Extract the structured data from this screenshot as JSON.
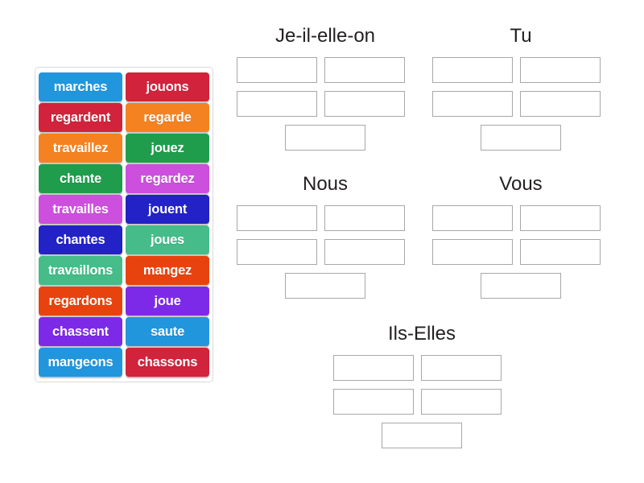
{
  "word_bank": {
    "label": "word-bank",
    "tiles": [
      {
        "text": "marches",
        "color": "#2196dd"
      },
      {
        "text": "jouons",
        "color": "#d1233b"
      },
      {
        "text": "regardent",
        "color": "#d1233b"
      },
      {
        "text": "regarde",
        "color": "#f58220"
      },
      {
        "text": "travaillez",
        "color": "#f58220"
      },
      {
        "text": "jouez",
        "color": "#1f9d4d"
      },
      {
        "text": "chante",
        "color": "#1f9d4d"
      },
      {
        "text": "regardez",
        "color": "#cc4fdd"
      },
      {
        "text": "travailles",
        "color": "#cc4fdd"
      },
      {
        "text": "jouent",
        "color": "#2222c7"
      },
      {
        "text": "chantes",
        "color": "#2222c7"
      },
      {
        "text": "joues",
        "color": "#45bc8a"
      },
      {
        "text": "travaillons",
        "color": "#45bc8a"
      },
      {
        "text": "mangez",
        "color": "#e8430f"
      },
      {
        "text": "regardons",
        "color": "#e8430f"
      },
      {
        "text": "joue",
        "color": "#7d2ae8"
      },
      {
        "text": "chassent",
        "color": "#7d2ae8"
      },
      {
        "text": "saute",
        "color": "#2196dd"
      },
      {
        "text": "mangeons",
        "color": "#2196dd"
      },
      {
        "text": "chassons",
        "color": "#d1233b"
      }
    ]
  },
  "groups": [
    {
      "id": "je",
      "title": "Je-il-elle-on",
      "slot_count": 5,
      "slots": [
        "",
        "",
        "",
        "",
        ""
      ]
    },
    {
      "id": "tu",
      "title": "Tu",
      "slot_count": 5,
      "slots": [
        "",
        "",
        "",
        "",
        ""
      ]
    },
    {
      "id": "nous",
      "title": "Nous",
      "slot_count": 5,
      "slots": [
        "",
        "",
        "",
        "",
        ""
      ]
    },
    {
      "id": "vous",
      "title": "Vous",
      "slot_count": 5,
      "slots": [
        "",
        "",
        "",
        "",
        ""
      ]
    },
    {
      "id": "ils",
      "title": "Ils-Elles",
      "slot_count": 5,
      "slots": [
        "",
        "",
        "",
        "",
        ""
      ]
    }
  ],
  "colors": {
    "background": "#ffffff",
    "slot_border": "#a8a8a8",
    "bank_border": "#d9d9d9",
    "title_text": "#231f20",
    "tile_text": "#ffffff"
  }
}
